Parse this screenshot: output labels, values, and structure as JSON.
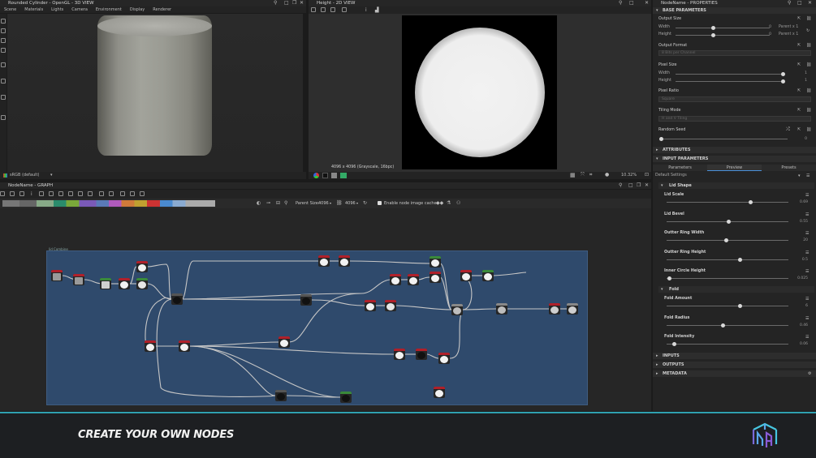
{
  "viewport3d": {
    "title": "Rounded Cylinder - OpenGL - 3D VIEW",
    "menu": [
      "Scene",
      "Materials",
      "Lights",
      "Camera",
      "Environment",
      "Display",
      "Renderer"
    ],
    "color_space": "sRGB (default)"
  },
  "viewport2d": {
    "title": "Height - 2D VIEW",
    "status": "4096 x 4096 (Grayscale, 16bpc)",
    "zoom": "10.32%"
  },
  "graph": {
    "title": "NodeName - GRAPH",
    "parent_size_label": "Parent Size:",
    "parent_size_w": "4096",
    "parent_size_h": "4096",
    "cache_label": "Enable node image cache",
    "frame_label": "lid Combine"
  },
  "properties": {
    "title": "NodeName - PROPERTIES",
    "base_section": "BASE PARAMETERS",
    "output_size": {
      "label": "Output Size",
      "width_label": "Width",
      "height_label": "Height",
      "width_value": "0",
      "height_value": "0",
      "width_mode": "Parent x 1",
      "height_mode": "Parent x 1",
      "width_fraction": 0.4,
      "height_fraction": 0.4
    },
    "output_format": {
      "label": "Output Format",
      "value": "8 Bits per Channel"
    },
    "pixel_size": {
      "label": "Pixel Size",
      "width_label": "Width",
      "height_label": "Height",
      "width_value": "1",
      "height_value": "1",
      "width_fraction": 1.0,
      "height_fraction": 1.0
    },
    "pixel_ratio": {
      "label": "Pixel Ratio",
      "value": "Square"
    },
    "tiling_mode": {
      "label": "Tiling Mode",
      "value": "H and V Tiling"
    },
    "random_seed": {
      "label": "Random Seed",
      "value": "0",
      "fraction": 0.0
    },
    "attributes_section": "ATTRIBUTES",
    "input_section": "INPUT PARAMETERS",
    "tabs": [
      "Parameters",
      "Preview",
      "Presets"
    ],
    "preset": "Default Settings",
    "lid_shape": {
      "label": "Lid Shape",
      "params": [
        {
          "label": "Lid Scale",
          "value": "0.69",
          "fraction": 0.69
        },
        {
          "label": "Lid Bevel",
          "value": "0.55",
          "fraction": 0.51
        },
        {
          "label": "Outter Ring Width",
          "value": "20",
          "fraction": 0.49
        },
        {
          "label": "Outter Ring Height",
          "value": "0.5",
          "fraction": 0.6
        },
        {
          "label": "Inner Circle Height",
          "value": "0.025",
          "fraction": 0.02
        }
      ]
    },
    "fold": {
      "label": "Fold",
      "params": [
        {
          "label": "Fold Amount",
          "value": "6",
          "fraction": 0.6
        },
        {
          "label": "Fold Radius",
          "value": "0.46",
          "fraction": 0.46
        },
        {
          "label": "Fold Intensity",
          "value": "0.06",
          "fraction": 0.06
        }
      ]
    },
    "inputs_section": "INPUTS",
    "outputs_section": "OUTPUTS",
    "metadata_section": "METADATA"
  },
  "banner": {
    "text": "CREATE YOUR OWN NODES"
  },
  "colors": {
    "accent": "#2fa0b0",
    "frame": "#2f4a6c",
    "node_red": "#b0202a",
    "node_grey": "#9a9a9a",
    "node_green": "#3a8a3a"
  }
}
